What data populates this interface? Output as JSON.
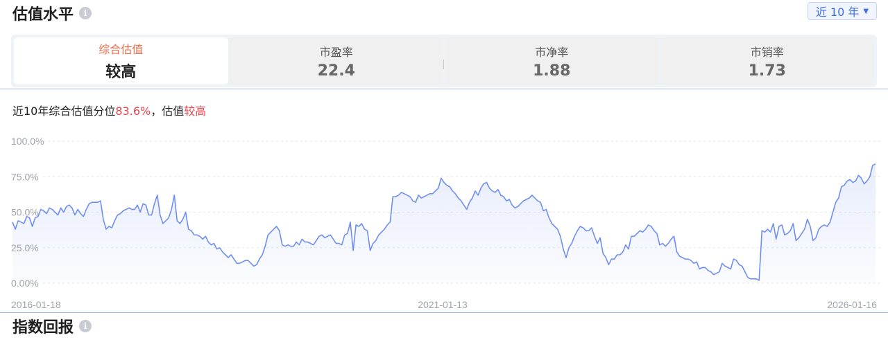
{
  "valuation": {
    "title": "估值水平",
    "info_icon": "i",
    "range_label": "近 10 年",
    "range_caret": "▼"
  },
  "metrics": [
    {
      "label": "综合估值",
      "value": "较高",
      "active": true
    },
    {
      "label": "市盈率",
      "value": "22.4",
      "active": false
    },
    {
      "label": "市净率",
      "value": "1.88",
      "active": false
    },
    {
      "label": "市销率",
      "value": "1.73",
      "active": false
    }
  ],
  "summary": {
    "prefix": "近10年综合估值分位",
    "percentile": "83.6%",
    "middle": "，估值",
    "level": "较高"
  },
  "colors": {
    "accent": "#3e6ee8",
    "line": "#6f8ff0",
    "highlight": "#e8424a",
    "active_label": "#ef6d4a"
  },
  "chart_data": {
    "type": "area",
    "title": "",
    "xlabel": "",
    "ylabel": "",
    "ylim": [
      0,
      100
    ],
    "y_ticks": [
      "100.0%",
      "75.0%",
      "50.0%",
      "25.0%",
      "0.00%"
    ],
    "y_tick_values": [
      100,
      75,
      50,
      25,
      0
    ],
    "x_ticks": [
      "2016-01-18",
      "2021-01-13",
      "2026-01-16"
    ],
    "x_range": [
      "2016-01-18",
      "2026-01-16"
    ],
    "grid": true,
    "legend": "none",
    "series": [
      {
        "values": [
          43,
          38,
          44,
          43,
          42,
          47,
          46,
          40,
          46,
          47,
          52,
          51,
          49,
          53,
          52,
          50,
          48,
          53,
          50,
          54,
          55,
          53,
          48,
          52,
          49,
          47,
          52,
          56,
          57,
          57,
          57,
          58,
          45,
          38,
          40,
          39,
          44,
          48,
          49,
          51,
          52,
          53,
          52,
          52,
          55,
          50,
          56,
          55,
          48,
          48,
          56,
          62,
          48,
          42,
          44,
          46,
          52,
          62,
          44,
          42,
          45,
          50,
          38,
          37,
          34,
          34,
          33,
          31,
          33,
          29,
          27,
          28,
          24,
          25,
          22,
          20,
          18,
          20,
          17,
          14,
          14,
          15,
          16,
          16,
          14,
          12,
          13,
          17,
          20,
          26,
          34,
          36,
          38,
          40,
          37,
          27,
          26,
          27,
          26,
          26,
          29,
          27,
          31,
          29,
          29,
          28,
          27,
          30,
          33,
          34,
          32,
          33,
          34,
          31,
          28,
          28,
          27,
          34,
          35,
          43,
          23,
          41,
          40,
          42,
          38,
          37,
          23,
          28,
          30,
          34,
          36,
          38,
          41,
          43,
          61,
          61,
          62,
          64,
          63,
          62,
          61,
          58,
          57,
          62,
          60,
          61,
          62,
          63,
          63,
          65,
          67,
          74,
          71,
          69,
          68,
          65,
          63,
          60,
          58,
          55,
          52,
          57,
          60,
          65,
          62,
          67,
          70,
          71,
          67,
          65,
          64,
          66,
          62,
          61,
          58,
          59,
          55,
          53,
          54,
          56,
          58,
          59,
          60,
          62,
          60,
          58,
          57,
          51,
          52,
          46,
          42,
          40,
          38,
          33,
          24,
          18,
          25,
          28,
          33,
          37,
          40,
          39,
          37,
          37,
          39,
          33,
          28,
          32,
          21,
          18,
          13,
          17,
          17,
          20,
          20,
          22,
          27,
          24,
          33,
          33,
          35,
          37,
          36,
          38,
          41,
          40,
          37,
          35,
          27,
          28,
          26,
          28,
          31,
          33,
          22,
          19,
          18,
          17,
          17,
          16,
          14,
          15,
          10,
          11,
          11,
          9,
          8,
          6,
          7,
          8,
          14,
          12,
          11,
          10,
          17,
          16,
          13,
          12,
          8,
          4,
          3,
          3,
          3,
          2,
          37,
          36,
          38,
          36,
          42,
          31,
          40,
          41,
          34,
          35,
          37,
          42,
          30,
          32,
          35,
          38,
          45,
          40,
          30,
          32,
          38,
          40,
          41,
          40,
          43,
          50,
          57,
          60,
          68,
          69,
          72,
          73,
          71,
          72,
          76,
          74,
          70,
          72,
          75,
          83,
          84
        ]
      }
    ]
  },
  "returns": {
    "title": "指数回报",
    "info_icon": "i"
  }
}
